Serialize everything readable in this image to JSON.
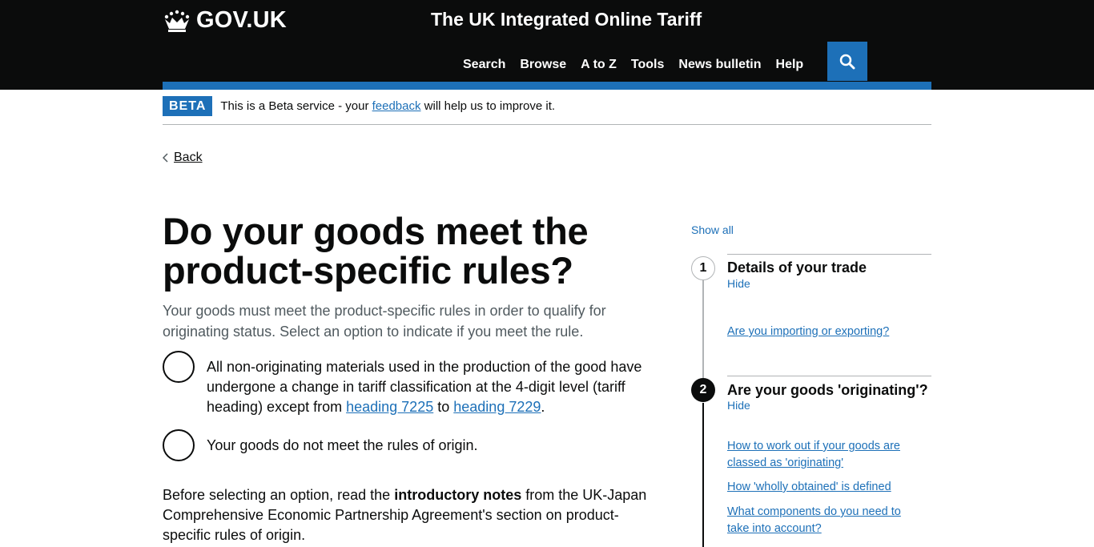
{
  "header": {
    "logo_text": "GOV.UK",
    "service_name": "The UK Integrated Online Tariff",
    "nav": [
      "Search",
      "Browse",
      "A to Z",
      "Tools",
      "News bulletin",
      "Help"
    ],
    "colors": {
      "background": "#0b0c0c",
      "accent": "#1d70b8"
    }
  },
  "beta": {
    "tag": "BETA",
    "text_before": "This is a Beta service - your",
    "link": "feedback",
    "text_after": "will help us to improve it."
  },
  "back": {
    "label": "Back"
  },
  "main": {
    "title": "Do your goods meet the product-specific rules?",
    "lead": "Your goods must meet the product-specific rules in order to qualify for originating status. Select an option to indicate if you meet the rule.",
    "option1": {
      "text_before": "All non-originating materials used in the production of the good have undergone a change in tariff classification at the 4-digit level (tariff heading) except from",
      "link1": "heading 7225",
      "middle": "to",
      "link2": "heading 7229",
      "end": "."
    },
    "option2": {
      "label": "Your goods do not meet the rules of origin."
    },
    "notes": {
      "before": "Before selecting an option, read the",
      "bold": "introductory notes",
      "after": "from the UK-Japan Comprehensive Economic Partnership Agreement's section on product-specific rules of origin."
    }
  },
  "sidebar": {
    "show_all": "Show all",
    "steps": [
      {
        "number": "1",
        "title": "Details of your trade",
        "toggle": "Hide",
        "links": [
          "Are you importing or exporting?"
        ]
      },
      {
        "number": "2",
        "title": "Are your goods 'originating'?",
        "toggle": "Hide",
        "links": [
          "How to work out if your goods are classed as 'originating'",
          "How 'wholly obtained' is defined",
          "What components do you need to take into account?"
        ]
      }
    ]
  }
}
